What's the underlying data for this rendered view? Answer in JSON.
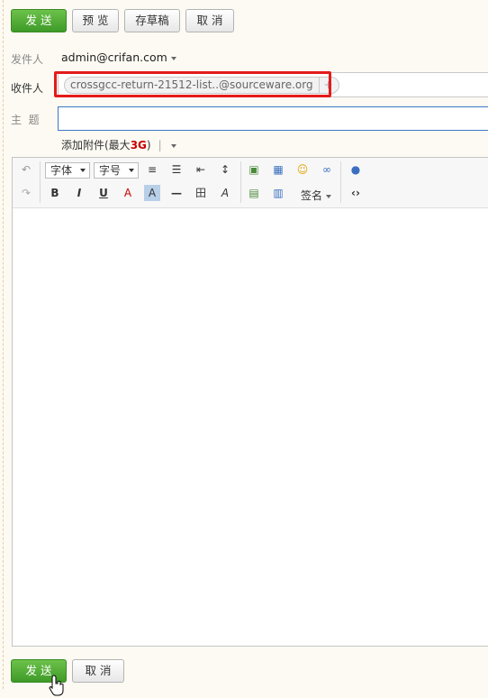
{
  "top_actions": {
    "send": "发 送",
    "preview": "预 览",
    "draft": "存草稿",
    "cancel": "取 消"
  },
  "sender": {
    "label": "发件人",
    "value": "admin@crifan.com"
  },
  "recipient": {
    "label": "收件人",
    "chip": "crossgcc-return-21512-list..@sourceware.org",
    "chip_add": "+"
  },
  "subject": {
    "label": "主  题",
    "value": ""
  },
  "attachment": {
    "prefix": "添加附件(最大",
    "size": "3G",
    "suffix": ")"
  },
  "toolbar": {
    "font": "字体",
    "font_size": "字号",
    "signature": "签名"
  },
  "bottom_actions": {
    "send": "发 送",
    "cancel": "取 消"
  },
  "colors": {
    "primary": "#4ca334",
    "highlight": "#e41b1b",
    "focus": "#3b78c9"
  }
}
